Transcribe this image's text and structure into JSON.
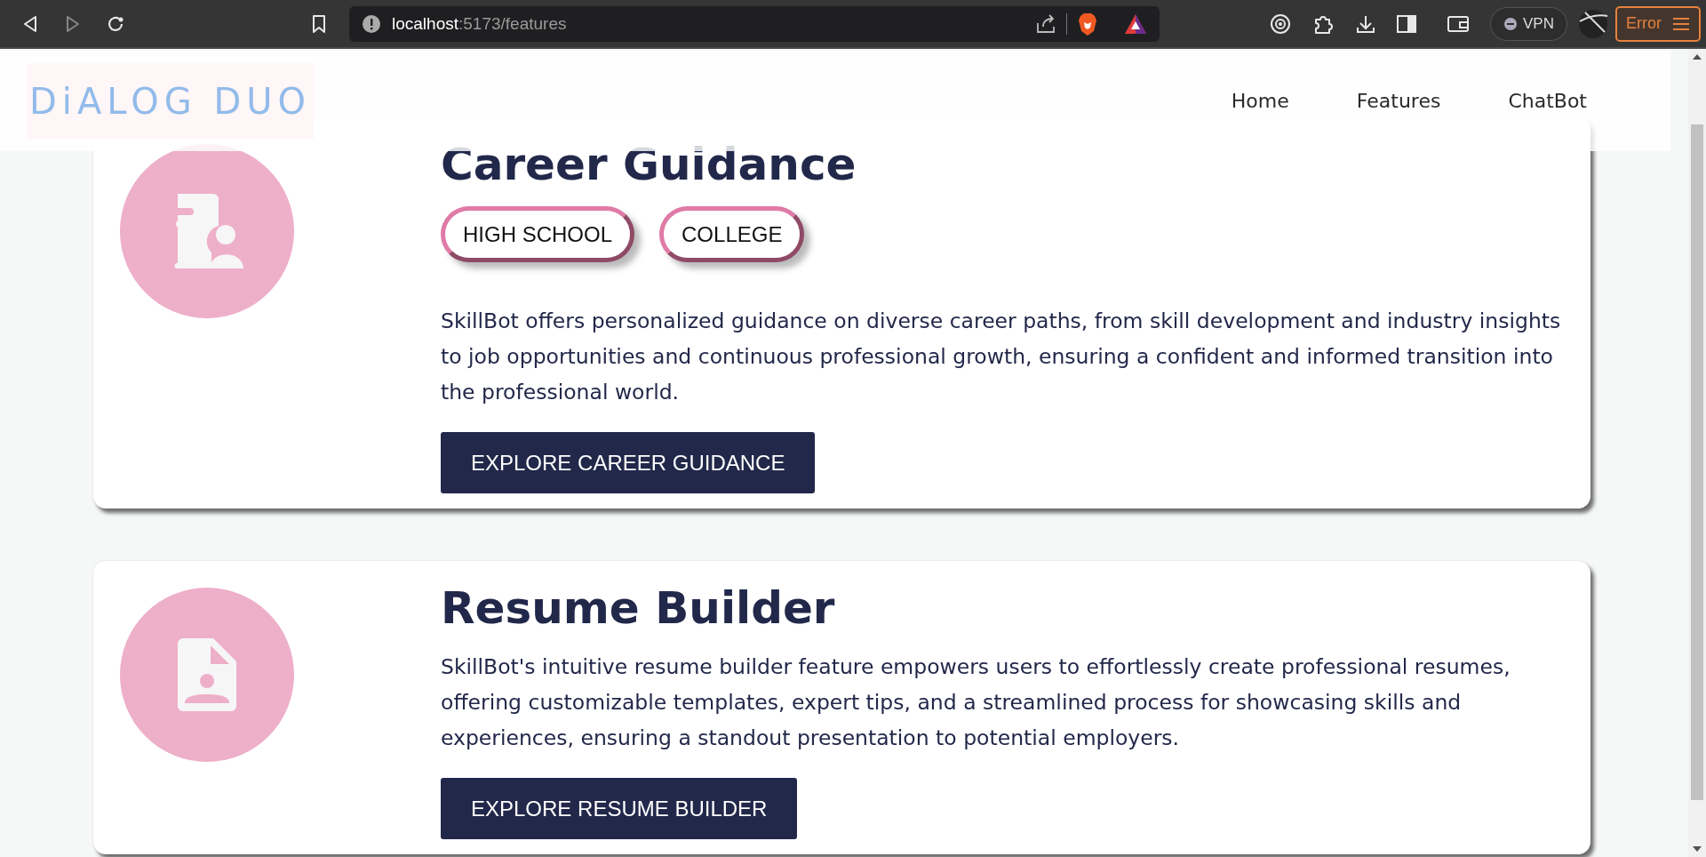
{
  "browser": {
    "address": {
      "host": "localhost",
      "path": ":5173/features"
    },
    "vpn": "VPN",
    "error": "Error"
  },
  "header": {
    "logo": "DiALOG DUO",
    "nav": [
      {
        "label": "Home"
      },
      {
        "label": "Features"
      },
      {
        "label": "ChatBot"
      }
    ]
  },
  "features": [
    {
      "kind": "guidance",
      "title": "Career Guidance",
      "tags": [
        "HIGH SCHOOL",
        "COLLEGE"
      ],
      "description": "SkillBot offers personalized guidance on diverse career paths, from skill development and industry insights to job opportunities and continuous professional growth, ensuring a confident and informed transition into the professional world.",
      "button": "EXPLORE CAREER GUIDANCE"
    },
    {
      "kind": "resume",
      "title": "Resume Builder",
      "description": "SkillBot's intuitive resume builder feature empowers users to effortlessly create professional resumes, offering customizable templates, expert tips, and a streamlined process for showcasing skills and experiences, ensuring a standout presentation to potential employers.",
      "button": "EXPLORE RESUME BUILDER"
    }
  ]
}
